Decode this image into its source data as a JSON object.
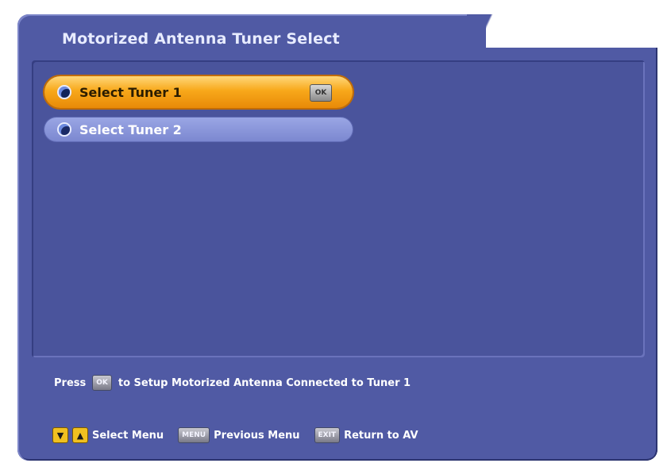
{
  "title": "Motorized Antenna Tuner Select",
  "menu": {
    "items": [
      {
        "label": "Select Tuner 1",
        "selected": true,
        "key_label": "OK"
      },
      {
        "label": "Select Tuner 2",
        "selected": false
      }
    ]
  },
  "help": {
    "prefix": "Press",
    "key": "OK",
    "suffix": "to Setup Motorized Antenna Connected to Tuner 1"
  },
  "footer": {
    "nav": {
      "keys": [
        "▼",
        "▲"
      ],
      "label": "Select Menu"
    },
    "menu": {
      "key": "MENU",
      "label": "Previous Menu"
    },
    "exit": {
      "key": "EXIT",
      "label": "Return to AV"
    }
  },
  "colors": {
    "panel": "#505aa4",
    "selected_highlight": "#f8a81a",
    "item_normal": "#7c88d0",
    "text": "#ffffff"
  }
}
